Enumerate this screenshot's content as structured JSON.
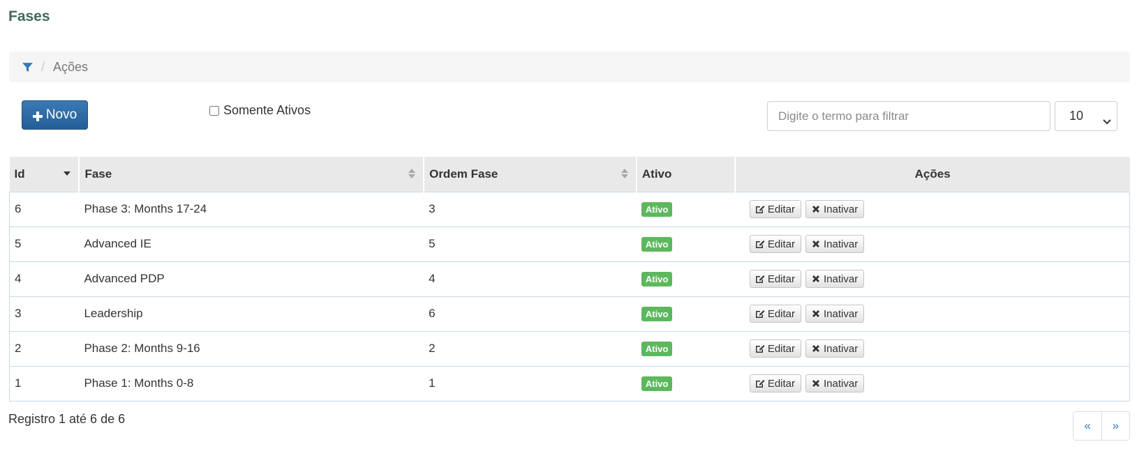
{
  "page": {
    "title": "Fases"
  },
  "breadcrumb": {
    "current": "Ações",
    "separator": "/"
  },
  "toolbar": {
    "new_label": "Novo",
    "only_active_label": "Somente Ativos",
    "only_active_checked": false,
    "search_placeholder": "Digite o termo para filtrar",
    "search_value": "",
    "page_size": "10"
  },
  "table": {
    "columns": [
      "Id",
      "Fase",
      "Ordem Fase",
      "Ativo",
      "Ações"
    ],
    "sort": {
      "column": "Id",
      "direction": "desc"
    },
    "rows": [
      {
        "id": "6",
        "fase": "Phase 3: Months 17-24",
        "ordem": "3",
        "ativo": "Ativo"
      },
      {
        "id": "5",
        "fase": "Advanced IE",
        "ordem": "5",
        "ativo": "Ativo"
      },
      {
        "id": "4",
        "fase": "Advanced PDP",
        "ordem": "4",
        "ativo": "Ativo"
      },
      {
        "id": "3",
        "fase": "Leadership",
        "ordem": "6",
        "ativo": "Ativo"
      },
      {
        "id": "2",
        "fase": "Phase 2: Months 9-16",
        "ordem": "2",
        "ativo": "Ativo"
      },
      {
        "id": "1",
        "fase": "Phase 1: Months 0-8",
        "ordem": "1",
        "ativo": "Ativo"
      }
    ],
    "edit_label": "Editar",
    "deactivate_label": "Inativar"
  },
  "footer": {
    "info": "Registro 1 até 6 de 6",
    "prev": "«",
    "next": "»"
  },
  "colors": {
    "title": "#3f6a5c",
    "primary": "#245e96",
    "success": "#5cb85c",
    "link": "#337ab7"
  },
  "icons": {
    "breadcrumb": "filter-icon",
    "new": "plus-icon",
    "edit": "edit-icon",
    "deactivate": "close-icon",
    "page_size": "chevron-down-icon"
  }
}
